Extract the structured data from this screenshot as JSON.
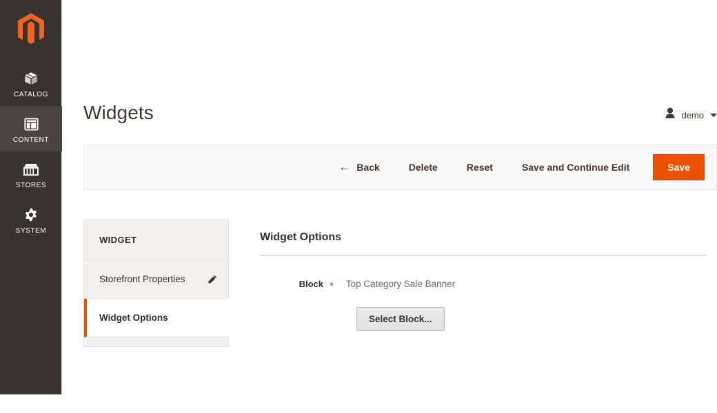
{
  "sidebar": {
    "logo": {
      "icon": "magento-logo-icon",
      "color": "#f26322"
    },
    "items": [
      {
        "label": "CATALOG",
        "icon": "catalog-box-icon",
        "active": false
      },
      {
        "label": "CONTENT",
        "icon": "content-layout-icon",
        "active": true
      },
      {
        "label": "STORES",
        "icon": "stores-storefront-icon",
        "active": false
      },
      {
        "label": "SYSTEM",
        "icon": "system-gear-icon",
        "active": false
      }
    ]
  },
  "header": {
    "title": "Widgets",
    "user": {
      "name": "demo",
      "avatar_icon": "user-avatar-icon",
      "caret_icon": "chevron-down-icon"
    }
  },
  "toolbar": {
    "back_label": "Back",
    "back_arrow": "←",
    "delete_label": "Delete",
    "reset_label": "Reset",
    "save_continue_label": "Save and Continue Edit",
    "save_label": "Save",
    "primary_color": "#eb5202"
  },
  "tabs": {
    "group_title": "WIDGET",
    "items": [
      {
        "label": "Storefront Properties",
        "icon": "pencil-edit-icon",
        "active": false
      },
      {
        "label": "Widget Options",
        "icon": "",
        "active": true
      }
    ],
    "active_marker_color": "#eb5202"
  },
  "main": {
    "section_title": "Widget Options",
    "fields": [
      {
        "label": "Block",
        "required_mark": "*",
        "value": "Top Category Sale Banner",
        "button_label": "Select Block..."
      }
    ]
  }
}
